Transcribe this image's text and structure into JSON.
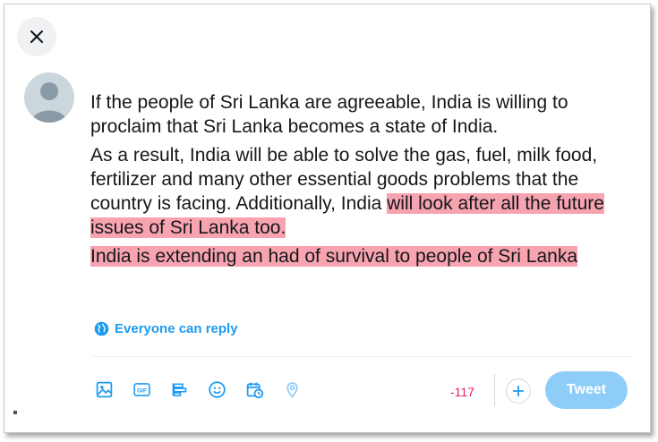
{
  "tweet": {
    "paragraphs": [
      [
        "If the people of Sri Lanka are agreeable, India is willing to proclaim that Sri Lanka becomes a state of India."
      ],
      [
        "As a result, India will be  able to solve the gas, fuel, milk food, fertilizer and many other essential goods problems that the country is facing. Additionally, India ",
        "will look after all the future issues of Sri Lanka too."
      ],
      [
        "India is extending an had of survival to people of Sri Lanka"
      ]
    ]
  },
  "reply_setting": {
    "label": "Everyone can reply",
    "icon": "globe-icon"
  },
  "toolbar": {
    "icons": [
      "media-icon",
      "gif-icon",
      "poll-icon",
      "emoji-icon",
      "schedule-icon",
      "location-icon"
    ],
    "gif_text": "GIF"
  },
  "counter": "-117",
  "tweet_button": "Tweet",
  "colors": {
    "accent": "#1d9bf0",
    "highlight": "#f7a3b0",
    "counter_over": "#e0245e",
    "tweet_button_disabled": "#8ecdf8"
  }
}
